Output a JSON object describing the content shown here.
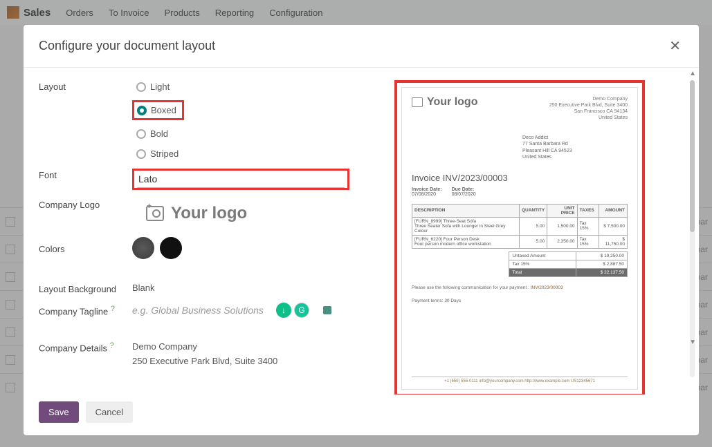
{
  "topnav": {
    "brand": "Sales",
    "items": [
      "Orders",
      "To Invoice",
      "Products",
      "Reporting",
      "Configuration"
    ]
  },
  "modal": {
    "title": "Configure your document layout",
    "save": "Save",
    "cancel": "Cancel"
  },
  "labels": {
    "layout": "Layout",
    "font": "Font",
    "company_logo": "Company Logo",
    "colors": "Colors",
    "layout_background": "Layout Background",
    "company_tagline": "Company Tagline",
    "company_details": "Company Details"
  },
  "layout_options": {
    "light": "Light",
    "boxed": "Boxed",
    "bold": "Bold",
    "striped": "Striped",
    "selected": "Boxed"
  },
  "font": {
    "value": "Lato"
  },
  "logo_placeholder": "Your logo",
  "colors": {
    "primary": "#4a4a4a",
    "secondary": "#111111"
  },
  "layout_background": "Blank",
  "tagline": {
    "placeholder": "e.g. Global Business Solutions",
    "value": ""
  },
  "company_details": {
    "line1": "Demo Company",
    "line2": "250 Executive Park Blvd, Suite 3400"
  },
  "preview": {
    "logo_text": "Your logo",
    "company": [
      "Demo Company",
      "250 Executive Park Blvd, Suite 3400",
      "San Francisco CA 94134",
      "United States"
    ],
    "customer": [
      "Deco Addict",
      "77 Santa Barbara Rd",
      "Pleasant Hill CA 94523",
      "United States"
    ],
    "title": "Invoice INV/2023/00003",
    "dates": {
      "invoice_label": "Invoice Date:",
      "invoice": "07/08/2020",
      "due_label": "Due Date:",
      "due": "08/07/2020"
    },
    "columns": [
      "DESCRIPTION",
      "QUANTITY",
      "UNIT PRICE",
      "TAXES",
      "AMOUNT"
    ],
    "lines": [
      {
        "desc": "[FURN_8999] Three-Seat Sofa",
        "desc2": "Three Seater Sofa with Lounger in Steel Grey Colour",
        "qty": "5.00",
        "unit": "1,500.00",
        "tax": "Tax 15%",
        "amount": "$ 7,500.00"
      },
      {
        "desc": "[FURN_6220] Four Person Desk",
        "desc2": "Four person modern office workstation",
        "qty": "5.00",
        "unit": "2,350.00",
        "tax": "Tax 15%",
        "amount": "$ 11,750.00"
      }
    ],
    "totals": {
      "untaxed_label": "Untaxed Amount",
      "untaxed": "$ 19,250.00",
      "tax_label": "Tax 15%",
      "tax": "$ 2,887.50",
      "total_label": "Total",
      "total": "$ 22,137.50"
    },
    "note1a": "Please use the following communication for your payment : ",
    "note1b": "INV/2023/00003",
    "note2": "Payment terms: 30 Days",
    "footer": "+1 (650) 555-0111 info@yourcompany.com http://www.example.com US12345671"
  },
  "bg_right": "par"
}
